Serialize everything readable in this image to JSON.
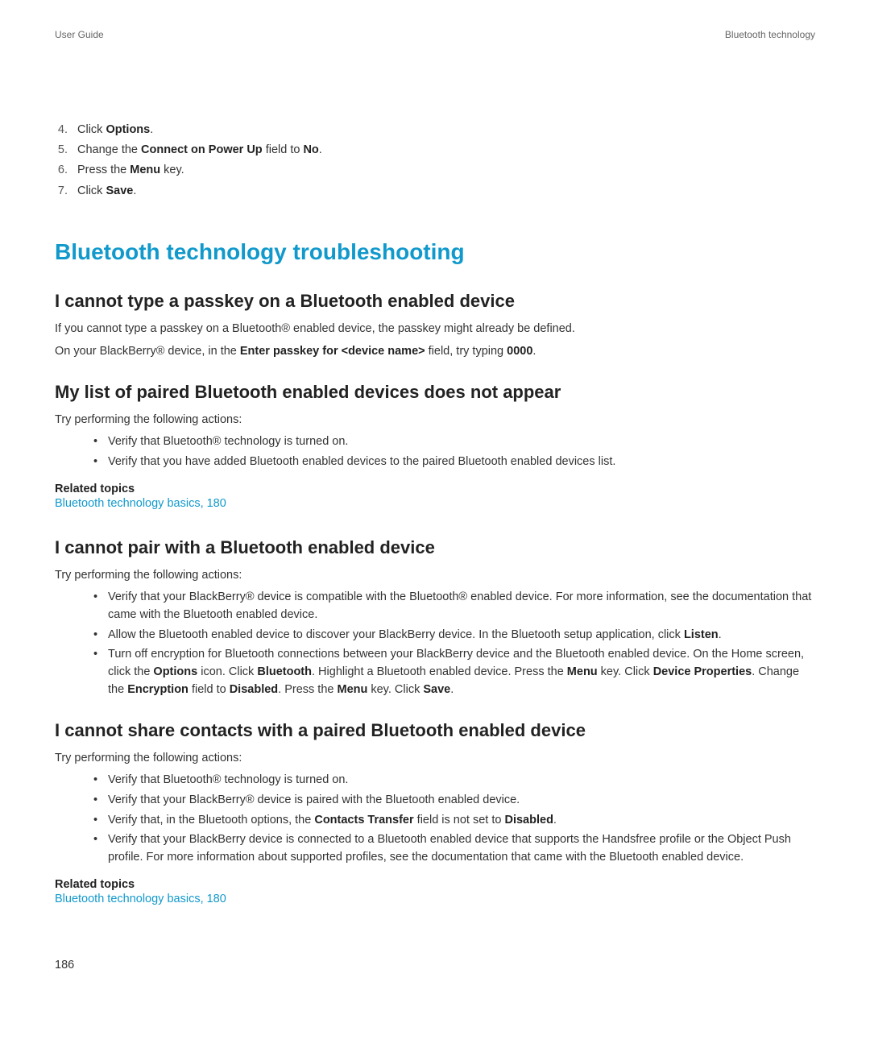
{
  "header": {
    "left": "User Guide",
    "right": "Bluetooth technology"
  },
  "steps": [
    {
      "num": "4.",
      "pre": "Click ",
      "bold": "Options",
      "post": "."
    },
    {
      "num": "5.",
      "pre": "Change the ",
      "bold": "Connect on Power Up",
      "post": " field to ",
      "bold2": "No",
      "post2": "."
    },
    {
      "num": "6.",
      "pre": "Press the ",
      "bold": "Menu",
      "post": " key."
    },
    {
      "num": "7.",
      "pre": "Click ",
      "bold": "Save",
      "post": "."
    }
  ],
  "sectionTitle": "Bluetooth technology troubleshooting",
  "sub1": {
    "title": "I cannot type a passkey on a Bluetooth enabled device",
    "p1": "If you cannot type a passkey on a Bluetooth® enabled device, the passkey might already be defined.",
    "p2_pre": "On your BlackBerry® device, in the ",
    "p2_b1": "Enter passkey for <device name>",
    "p2_mid": " field, try typing ",
    "p2_b2": "0000",
    "p2_post": "."
  },
  "sub2": {
    "title": "My list of paired Bluetooth enabled devices does not appear",
    "intro": "Try performing the following actions:",
    "bullets": [
      "Verify that Bluetooth® technology is turned on.",
      "Verify that you have added Bluetooth enabled devices to the paired Bluetooth enabled devices list."
    ],
    "relatedHeading": "Related topics",
    "relatedLink": "Bluetooth technology basics, 180"
  },
  "sub3": {
    "title": "I cannot pair with a Bluetooth enabled device",
    "intro": "Try performing the following actions:",
    "b1": "Verify that your BlackBerry® device is compatible with the Bluetooth® enabled device. For more information, see the documentation that came with the Bluetooth enabled device.",
    "b2_pre": "Allow the Bluetooth enabled device to discover your BlackBerry device. In the Bluetooth setup application, click ",
    "b2_bold": "Listen",
    "b2_post": ".",
    "b3_pre": "Turn off encryption for Bluetooth connections between your BlackBerry device and the Bluetooth enabled device. On the Home screen, click the ",
    "b3_b1": "Options",
    "b3_m1": " icon. Click ",
    "b3_b2": "Bluetooth",
    "b3_m2": ". Highlight a Bluetooth enabled device. Press the ",
    "b3_b3": "Menu",
    "b3_m3": " key. Click ",
    "b3_b4": "Device Properties",
    "b3_m4": ". Change the ",
    "b3_b5": "Encryption",
    "b3_m5": " field to ",
    "b3_b6": "Disabled",
    "b3_m6": ". Press the ",
    "b3_b7": "Menu",
    "b3_m7": " key. Click ",
    "b3_b8": "Save",
    "b3_m8": "."
  },
  "sub4": {
    "title": "I cannot share contacts with a paired Bluetooth enabled device",
    "intro": "Try performing the following actions:",
    "b1": "Verify that Bluetooth® technology is turned on.",
    "b2": "Verify that your BlackBerry® device is paired with the Bluetooth enabled device.",
    "b3_pre": "Verify that, in the Bluetooth options, the ",
    "b3_b1": "Contacts Transfer",
    "b3_mid": " field is not set to ",
    "b3_b2": "Disabled",
    "b3_post": ".",
    "b4": "Verify that your BlackBerry device is connected to a Bluetooth enabled device that supports the Handsfree profile or the Object Push profile. For more information about supported profiles, see the documentation that came with the Bluetooth enabled device.",
    "relatedHeading": "Related topics",
    "relatedLink": "Bluetooth technology basics, 180"
  },
  "pageNum": "186"
}
